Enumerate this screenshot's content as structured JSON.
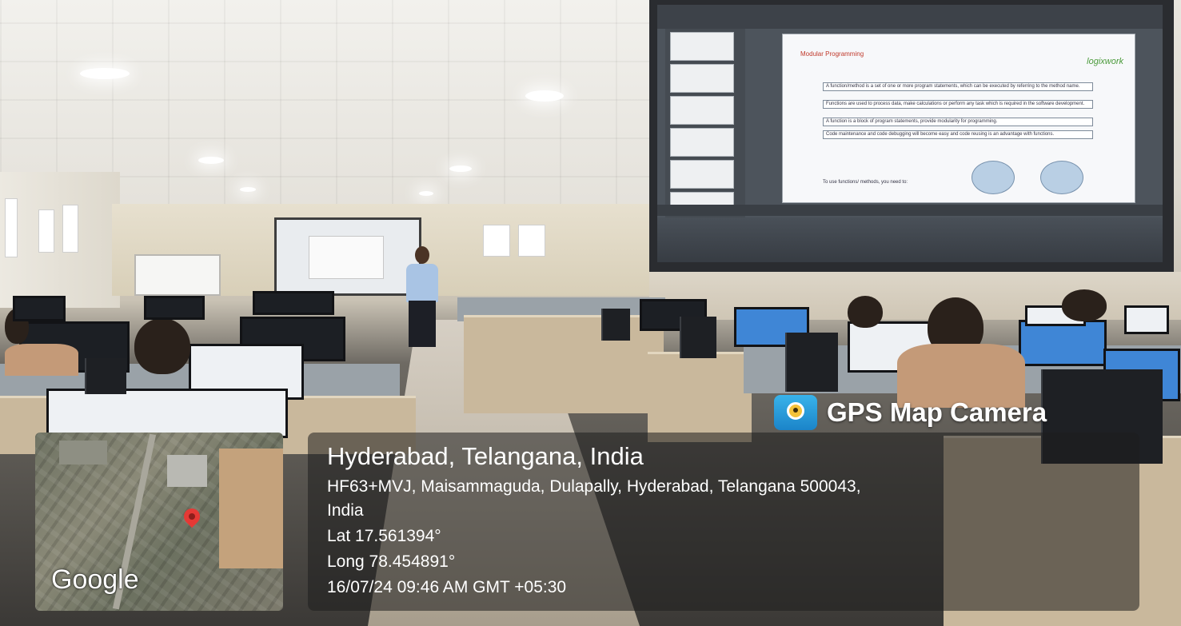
{
  "overlay": {
    "app_name": "GPS Map Camera",
    "location_title": "Hyderabad, Telangana, India",
    "address_line1": "HF63+MVJ, Maisammaguda, Dulapally, Hyderabad, Telangana 500043,",
    "address_line2": "India",
    "latitude": "Lat 17.561394°",
    "longitude": "Long 78.454891°",
    "datetime": "16/07/24 09:46 AM GMT +05:30",
    "map_brand": "Google"
  },
  "projected_slide": {
    "title": "Modular Programming",
    "logo": "logixwork",
    "points": [
      "A function/method is a set of one or more program statements, which can be executed by referring to the method name.",
      "Functions are used to process data, make calculations or perform any task which is required in the software development.",
      "A function is a block of program statements, provide modularity for programming.",
      "Code maintenance and code debugging will become easy and code reusing is an advantage with functions."
    ],
    "footer": "To use functions/ methods, you need to:"
  },
  "colors": {
    "pin": "#e53935",
    "gps_icon": "#1b84c9",
    "panel": "rgba(30,30,30,0.55)"
  }
}
